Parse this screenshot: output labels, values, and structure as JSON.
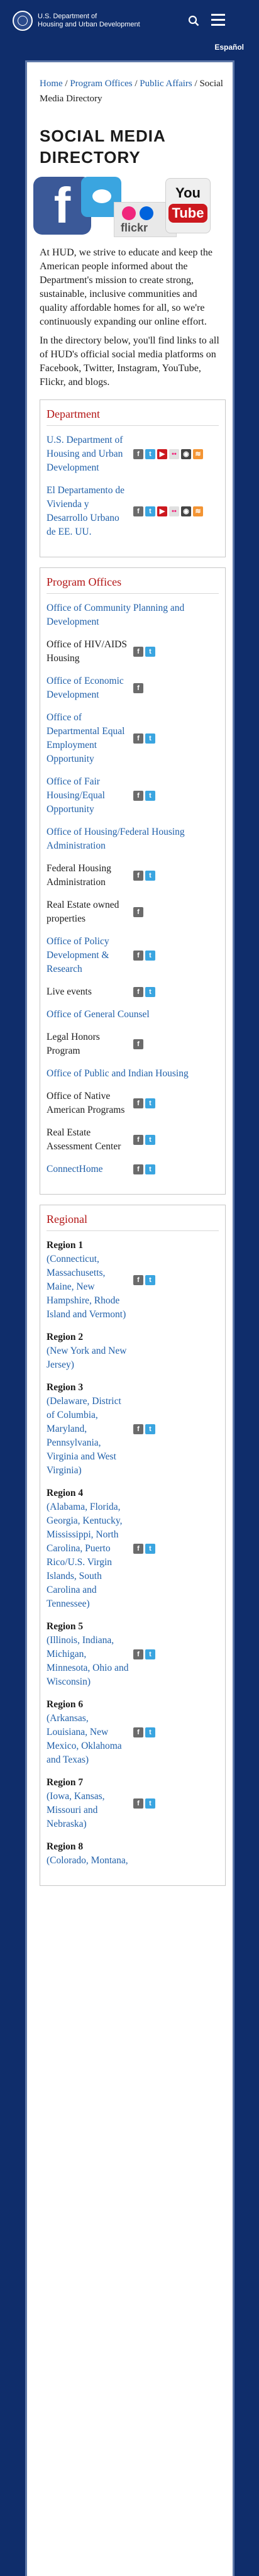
{
  "header": {
    "logo_line1": "U.S. Department of",
    "logo_line2": "Housing and Urban Development",
    "language_link": "Español"
  },
  "breadcrumb": {
    "home": "Home",
    "program_offices": "Program Offices",
    "public_affairs": "Public Affairs",
    "current": "Social Media Directory"
  },
  "page_title": "SOCIAL MEDIA DIRECTORY",
  "banner": {
    "flickr_word": "flickr",
    "youtube_you": "You",
    "youtube_tube": "Tube"
  },
  "intro": [
    "At HUD, we strive to educate and keep the American people informed about the Department's mission to create strong, sustainable, inclusive communities and quality affordable homes for all, so we're continuously expanding our online effort.",
    "In the directory below, you'll find links to all of HUD's official social media platforms on Facebook, Twitter, Instagram, YouTube, Flickr, and blogs."
  ],
  "department": {
    "heading": "Department",
    "rows": [
      {
        "name": "U.S. Department of Housing and Urban Development"
      },
      {
        "name": "El Departamento de Vivienda y Desarrollo Urbano de EE. UU."
      }
    ]
  },
  "program_offices": {
    "heading": "Program Offices",
    "office_cpd": "Office of Community Planning and Development",
    "hiv_aids": "Office of HIV/AIDS Housing",
    "economic_dev": "Office of Economic Development",
    "deo": "Office of Departmental Equal Employment Opportunity",
    "fheo": "Office of Fair Housing/Equal Opportunity",
    "fha_office": "Office of Housing/Federal Housing Administration",
    "fha": "Federal Housing Administration",
    "reo": "Real Estate owned properties",
    "pdr": "Office of Policy Development & Research",
    "live_events": "Live events",
    "ogc": "Office of General Counsel",
    "legal_honors": "Legal Honors Program",
    "pih": "Office of Public and Indian Housing",
    "onap": "Office of Native American Programs",
    "reac": "Real Estate Assessment Center",
    "connecthome": "ConnectHome"
  },
  "regional": {
    "heading": "Regional",
    "regions": [
      {
        "name": "Region 1",
        "states": "(Connecticut, Massachusetts, Maine, New Hampshire, Rhode Island and Vermont)"
      },
      {
        "name": "Region 2",
        "states": "(New York and New Jersey)"
      },
      {
        "name": "Region 3",
        "states": "(Delaware, District of Columbia, Maryland, Pennsylvania, Virginia and West Virginia)"
      },
      {
        "name": "Region 4",
        "states": "(Alabama, Florida, Georgia, Kentucky, Mississippi, North Carolina, Puerto Rico/U.S. Virgin Islands, South Carolina and Tennessee)"
      },
      {
        "name": "Region 5",
        "states": "(Illinois, Indiana, Michigan, Minnesota, Ohio and Wisconsin)"
      },
      {
        "name": "Region 6",
        "states": "(Arkansas, Louisiana, New Mexico, Oklahoma and Texas)"
      },
      {
        "name": "Region 7",
        "states": "(Iowa, Kansas, Missouri and Nebraska)"
      },
      {
        "name": "Region 8",
        "states": "(Colorado, Montana,"
      }
    ]
  },
  "icon_letters": {
    "facebook": "f",
    "twitter": "t",
    "instagram": "◎",
    "youtube": "▶",
    "flickr": "••",
    "github": "◉",
    "rss": "≋"
  },
  "colors": {
    "brand_navy": "#0f2d6b",
    "link_blue": "#1f5fa9",
    "heading_red": "#b31515",
    "twitter": "#3aa5e0",
    "facebook_gray": "#6b6b6b"
  }
}
